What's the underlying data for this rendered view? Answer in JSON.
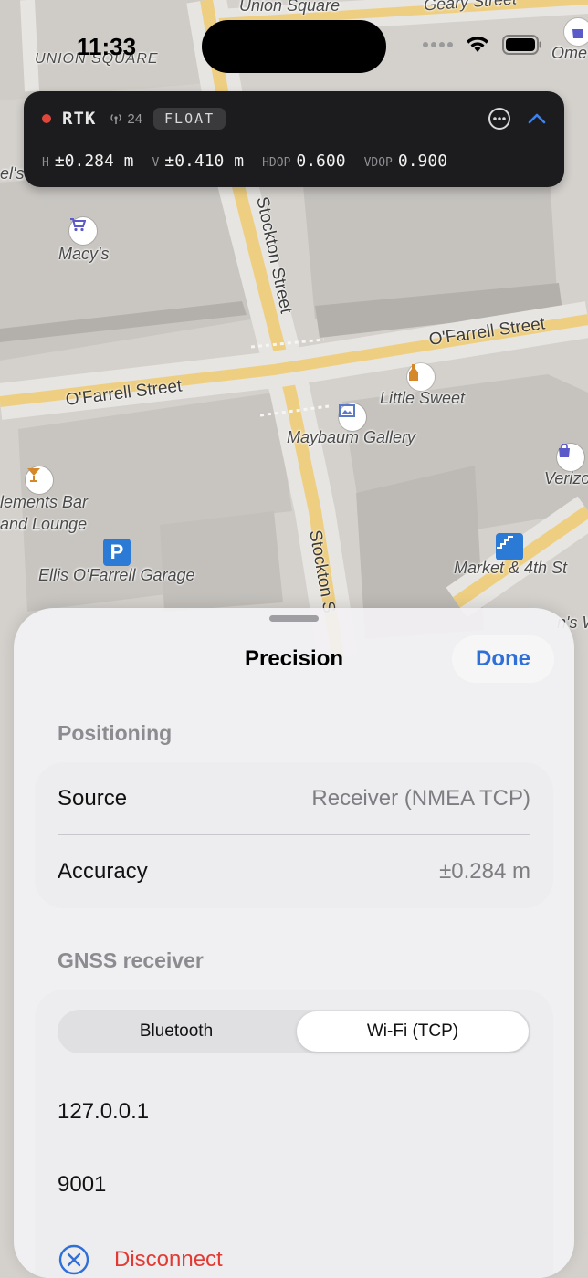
{
  "status_bar": {
    "time": "11:33"
  },
  "map": {
    "labels": {
      "union_square_street": "Union Square",
      "geary_street": "Geary Street",
      "union_square_area": "UNION SQUARE",
      "omega_partial": "Ome",
      "macys": "Macy's",
      "stockton_street_top": "Stockton Street",
      "stockton_street_bottom": "Stockton S",
      "ofarrell_left": "O'Farrell Street",
      "ofarrell_right": "O'Farrell Street",
      "little_sweet": "Little Sweet",
      "maybaum_gallery": "Maybaum Gallery",
      "verizon_partial": "Verizo",
      "elements_bar_1": "lements Bar",
      "elements_bar_2": "and Lounge",
      "ellis_garage": "Ellis O'Farrell Garage",
      "market_4th": "Market & 4th St",
      "left_partial_1": "el's",
      "right_partial": "n's W",
      "parking_symbol": "P"
    }
  },
  "rtk_panel": {
    "title": "RTK",
    "satellites": "24",
    "fix_badge": "FLOAT",
    "h_label": "H",
    "h_value": "±0.284 m",
    "v_label": "V",
    "v_value": "±0.410 m",
    "hdop_label": "HDOP",
    "hdop_value": "0.600",
    "vdop_label": "VDOP",
    "vdop_value": "0.900"
  },
  "sheet": {
    "title": "Precision",
    "done_label": "Done",
    "positioning": {
      "header": "Positioning",
      "source_label": "Source",
      "source_value": "Receiver (NMEA TCP)",
      "accuracy_label": "Accuracy",
      "accuracy_value": "±0.284 m"
    },
    "gnss": {
      "header": "GNSS receiver",
      "segments": [
        "Bluetooth",
        "Wi-Fi (TCP)"
      ],
      "selected_segment": "Wi-Fi (TCP)",
      "host_value": "127.0.0.1",
      "port_value": "9001",
      "disconnect_label": "Disconnect"
    }
  },
  "colors": {
    "accent": "#2f6fd8",
    "destructive": "#e23a33",
    "rtk_dot": "#e0463a",
    "panel_bg": "#1c1c1e"
  }
}
